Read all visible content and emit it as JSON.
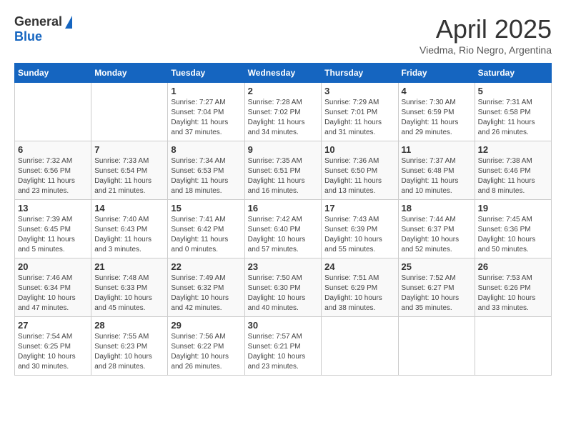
{
  "logo": {
    "general": "General",
    "blue": "Blue"
  },
  "title": {
    "month_year": "April 2025",
    "location": "Viedma, Rio Negro, Argentina"
  },
  "days_of_week": [
    "Sunday",
    "Monday",
    "Tuesday",
    "Wednesday",
    "Thursday",
    "Friday",
    "Saturday"
  ],
  "weeks": [
    [
      {
        "day": "",
        "info": ""
      },
      {
        "day": "",
        "info": ""
      },
      {
        "day": "1",
        "info": "Sunrise: 7:27 AM\nSunset: 7:04 PM\nDaylight: 11 hours and 37 minutes."
      },
      {
        "day": "2",
        "info": "Sunrise: 7:28 AM\nSunset: 7:02 PM\nDaylight: 11 hours and 34 minutes."
      },
      {
        "day": "3",
        "info": "Sunrise: 7:29 AM\nSunset: 7:01 PM\nDaylight: 11 hours and 31 minutes."
      },
      {
        "day": "4",
        "info": "Sunrise: 7:30 AM\nSunset: 6:59 PM\nDaylight: 11 hours and 29 minutes."
      },
      {
        "day": "5",
        "info": "Sunrise: 7:31 AM\nSunset: 6:58 PM\nDaylight: 11 hours and 26 minutes."
      }
    ],
    [
      {
        "day": "6",
        "info": "Sunrise: 7:32 AM\nSunset: 6:56 PM\nDaylight: 11 hours and 23 minutes."
      },
      {
        "day": "7",
        "info": "Sunrise: 7:33 AM\nSunset: 6:54 PM\nDaylight: 11 hours and 21 minutes."
      },
      {
        "day": "8",
        "info": "Sunrise: 7:34 AM\nSunset: 6:53 PM\nDaylight: 11 hours and 18 minutes."
      },
      {
        "day": "9",
        "info": "Sunrise: 7:35 AM\nSunset: 6:51 PM\nDaylight: 11 hours and 16 minutes."
      },
      {
        "day": "10",
        "info": "Sunrise: 7:36 AM\nSunset: 6:50 PM\nDaylight: 11 hours and 13 minutes."
      },
      {
        "day": "11",
        "info": "Sunrise: 7:37 AM\nSunset: 6:48 PM\nDaylight: 11 hours and 10 minutes."
      },
      {
        "day": "12",
        "info": "Sunrise: 7:38 AM\nSunset: 6:46 PM\nDaylight: 11 hours and 8 minutes."
      }
    ],
    [
      {
        "day": "13",
        "info": "Sunrise: 7:39 AM\nSunset: 6:45 PM\nDaylight: 11 hours and 5 minutes."
      },
      {
        "day": "14",
        "info": "Sunrise: 7:40 AM\nSunset: 6:43 PM\nDaylight: 11 hours and 3 minutes."
      },
      {
        "day": "15",
        "info": "Sunrise: 7:41 AM\nSunset: 6:42 PM\nDaylight: 11 hours and 0 minutes."
      },
      {
        "day": "16",
        "info": "Sunrise: 7:42 AM\nSunset: 6:40 PM\nDaylight: 10 hours and 57 minutes."
      },
      {
        "day": "17",
        "info": "Sunrise: 7:43 AM\nSunset: 6:39 PM\nDaylight: 10 hours and 55 minutes."
      },
      {
        "day": "18",
        "info": "Sunrise: 7:44 AM\nSunset: 6:37 PM\nDaylight: 10 hours and 52 minutes."
      },
      {
        "day": "19",
        "info": "Sunrise: 7:45 AM\nSunset: 6:36 PM\nDaylight: 10 hours and 50 minutes."
      }
    ],
    [
      {
        "day": "20",
        "info": "Sunrise: 7:46 AM\nSunset: 6:34 PM\nDaylight: 10 hours and 47 minutes."
      },
      {
        "day": "21",
        "info": "Sunrise: 7:48 AM\nSunset: 6:33 PM\nDaylight: 10 hours and 45 minutes."
      },
      {
        "day": "22",
        "info": "Sunrise: 7:49 AM\nSunset: 6:32 PM\nDaylight: 10 hours and 42 minutes."
      },
      {
        "day": "23",
        "info": "Sunrise: 7:50 AM\nSunset: 6:30 PM\nDaylight: 10 hours and 40 minutes."
      },
      {
        "day": "24",
        "info": "Sunrise: 7:51 AM\nSunset: 6:29 PM\nDaylight: 10 hours and 38 minutes."
      },
      {
        "day": "25",
        "info": "Sunrise: 7:52 AM\nSunset: 6:27 PM\nDaylight: 10 hours and 35 minutes."
      },
      {
        "day": "26",
        "info": "Sunrise: 7:53 AM\nSunset: 6:26 PM\nDaylight: 10 hours and 33 minutes."
      }
    ],
    [
      {
        "day": "27",
        "info": "Sunrise: 7:54 AM\nSunset: 6:25 PM\nDaylight: 10 hours and 30 minutes."
      },
      {
        "day": "28",
        "info": "Sunrise: 7:55 AM\nSunset: 6:23 PM\nDaylight: 10 hours and 28 minutes."
      },
      {
        "day": "29",
        "info": "Sunrise: 7:56 AM\nSunset: 6:22 PM\nDaylight: 10 hours and 26 minutes."
      },
      {
        "day": "30",
        "info": "Sunrise: 7:57 AM\nSunset: 6:21 PM\nDaylight: 10 hours and 23 minutes."
      },
      {
        "day": "",
        "info": ""
      },
      {
        "day": "",
        "info": ""
      },
      {
        "day": "",
        "info": ""
      }
    ]
  ]
}
